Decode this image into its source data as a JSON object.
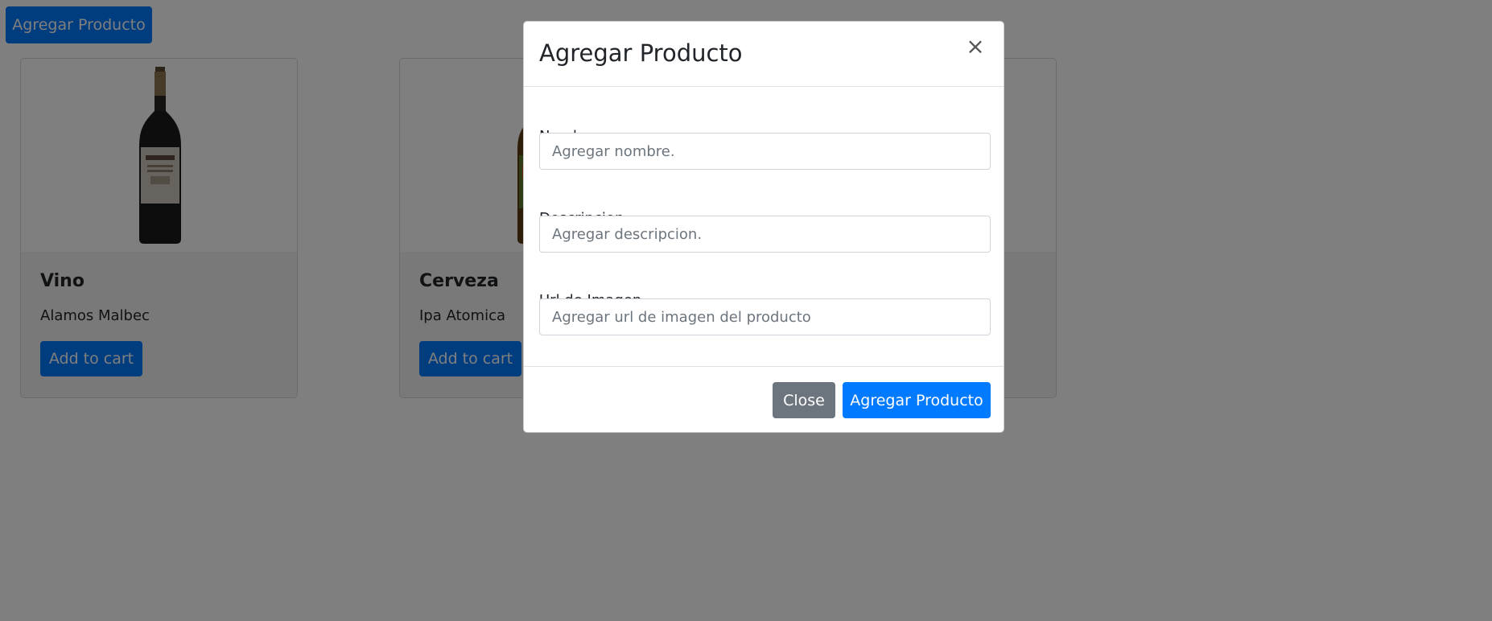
{
  "page": {
    "add_button_label": "Agregar Producto"
  },
  "products": [
    {
      "title": "Vino",
      "description": "Alamos Malbec",
      "button_label": "Add to cart"
    },
    {
      "title": "Cerveza",
      "description": "Ipa Atomica",
      "button_label": "Add to cart"
    }
  ],
  "modal": {
    "title": "Agregar Producto",
    "close_glyph": "×",
    "fields": [
      {
        "label": "Nombre",
        "placeholder": "Agregar nombre."
      },
      {
        "label": "Descripcion",
        "placeholder": "Agregar descripcion."
      },
      {
        "label": "Url de Imagen",
        "placeholder": "Agregar url de imagen del producto"
      }
    ],
    "close_label": "Close",
    "submit_label": "Agregar Producto"
  },
  "colors": {
    "primary": "#007bff",
    "secondary": "#6c757d",
    "backdrop": "rgba(0,0,0,0.5)"
  }
}
